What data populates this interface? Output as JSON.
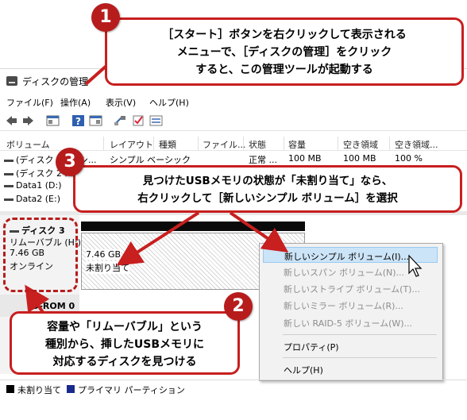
{
  "window": {
    "title": "ディスクの管理",
    "menu": [
      "ファイル(F)",
      "操作(A)",
      "表示(V)",
      "ヘルプ(H)"
    ]
  },
  "volume_list": {
    "columns": [
      "ボリューム",
      "レイアウト",
      "種類",
      "ファイル...",
      "状態",
      "容量",
      "空き領域",
      "空き領域..."
    ],
    "rows": [
      {
        "volume": "(ディスク 2",
        "layout": "シ...",
        "type": "シンプル ベーシック",
        "status": "正常 ...",
        "capacity": "100 MB",
        "free": "100 MB",
        "free_pct": "100 %"
      },
      {
        "volume": "(ディスク 2 パ",
        "layout": "",
        "type": "",
        "status": "",
        "capacity": "",
        "free": "",
        "free_pct": ""
      },
      {
        "volume": "Data1 (D:)",
        "layout": "",
        "type": "",
        "status": "",
        "capacity": "",
        "free": "",
        "free_pct": ""
      },
      {
        "volume": "Data2 (E:)",
        "layout": "",
        "type": "",
        "status": "",
        "capacity": "",
        "free": "",
        "free_pct": ""
      }
    ]
  },
  "disk3": {
    "name": "ディスク 3",
    "type": "リムーバブル (H:)",
    "size": "7.46 GB",
    "status": "オンライン",
    "partition_size": "7.46 GB",
    "partition_label": "未割り当て"
  },
  "cdrom": {
    "label": "D-ROM 0"
  },
  "legend": {
    "unallocated": "未割り当て",
    "primary": "プライマリ パーティション",
    "unallocated_color": "#000000",
    "primary_color": "#1a2a8c"
  },
  "context_menu": {
    "items": [
      {
        "label": "新しいシンプル ボリューム(I)...",
        "enabled": true,
        "highlighted": true
      },
      {
        "label": "新しいスパン ボリューム(N)...",
        "enabled": false
      },
      {
        "label": "新しいストライプ ボリューム(T)...",
        "enabled": false
      },
      {
        "label": "新しいミラー ボリューム(R)...",
        "enabled": false
      },
      {
        "label": "新しい RAID-5 ボリューム(W)...",
        "enabled": false
      },
      {
        "label": "プロパティ(P)",
        "enabled": true
      },
      {
        "label": "ヘルプ(H)",
        "enabled": true
      }
    ]
  },
  "callouts": {
    "c1": {
      "num": "1",
      "lines": [
        "［スタート］ボタンを右クリックして表示される",
        "メニューで、［ディスクの管理］をクリック",
        "すると、この管理ツールが起動する"
      ]
    },
    "c2": {
      "num": "2",
      "lines": [
        "容量や「リムーバブル」という",
        "種別から、挿したUSBメモリに",
        "対応するディスクを見つける"
      ]
    },
    "c3": {
      "num": "3",
      "lines": [
        "見つけたUSBメモリの状態が「未割り当て」なら、",
        "右クリックして［新しいシンプル ボリューム］を選択"
      ]
    }
  },
  "colors": {
    "accent_red": "#c81f1f",
    "highlight": "#cce4f7"
  }
}
